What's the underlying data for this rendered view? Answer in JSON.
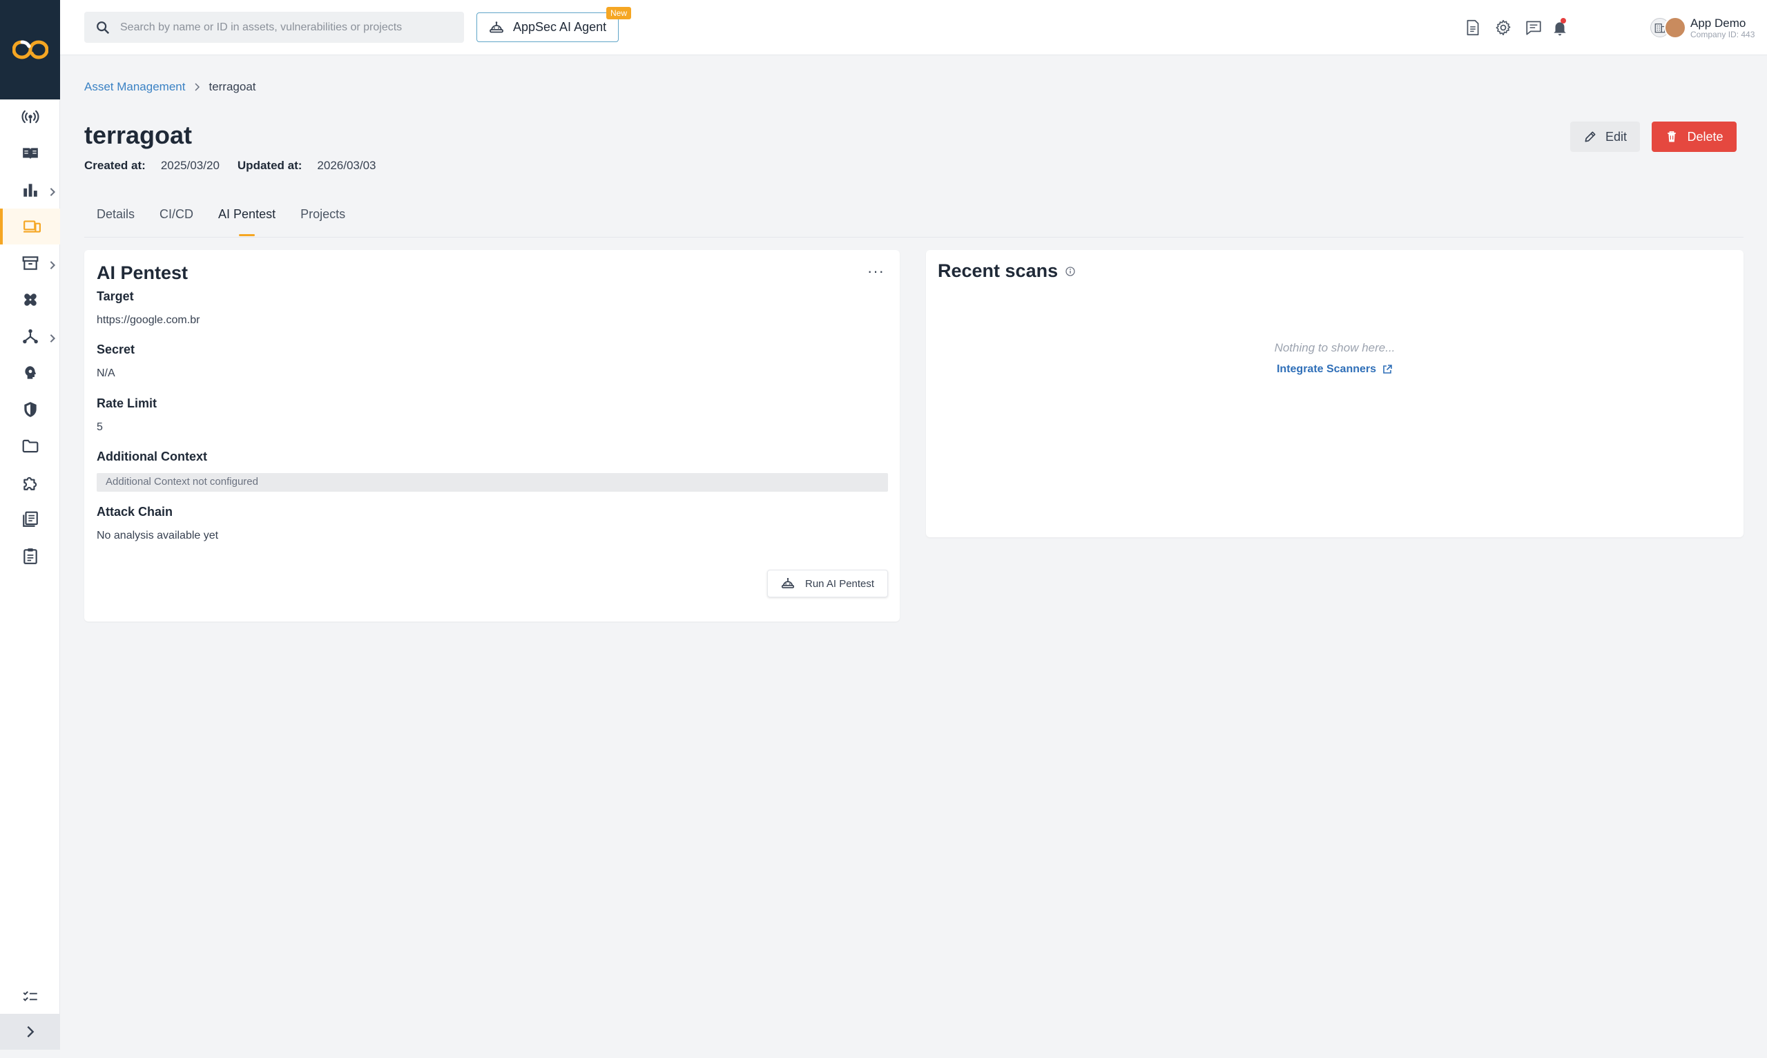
{
  "header": {
    "search_placeholder": "Search by name or ID in assets, vulnerabilities or projects",
    "agent_button": "AppSec AI Agent",
    "new_badge": "New",
    "user_name": "App Demo",
    "company_id": "Company ID: 443"
  },
  "breadcrumb": {
    "parent": "Asset Management",
    "current": "terragoat"
  },
  "page": {
    "title": "terragoat",
    "created_label": "Created at:",
    "created_value": "2025/03/20",
    "updated_label": "Updated at:",
    "updated_value": "2026/03/03",
    "edit_label": "Edit",
    "delete_label": "Delete"
  },
  "tabs": [
    {
      "label": "Details"
    },
    {
      "label": "CI/CD"
    },
    {
      "label": "AI Pentest"
    },
    {
      "label": "Projects"
    }
  ],
  "active_tab": "AI Pentest",
  "pentest": {
    "title": "AI Pentest",
    "more": "···",
    "target_label": "Target",
    "target_value": "https://google.com.br",
    "secret_label": "Secret",
    "secret_value": "N/A",
    "rate_label": "Rate Limit",
    "rate_value": "5",
    "context_label": "Additional Context",
    "context_value": "Additional Context not configured",
    "chain_label": "Attack Chain",
    "chain_value": "No analysis available yet",
    "run_button": "Run AI Pentest"
  },
  "recent": {
    "title": "Recent scans",
    "empty": "Nothing to show here...",
    "integrate": "Integrate Scanners"
  },
  "colors": {
    "accent": "#f5a623",
    "danger": "#e5483f",
    "link": "#3b82c4",
    "sidebar_logo_bg": "#1a2b3c"
  },
  "icons": {
    "sidebar": [
      "signal-icon",
      "book-icon",
      "bar-chart-icon",
      "devices-icon",
      "archive-icon",
      "bandage-icon",
      "network-icon",
      "brain-icon",
      "shield-icon",
      "folder-icon",
      "puzzle-icon",
      "reports-icon",
      "clipboard-icon",
      "checklist-icon",
      "chevron-right-icon"
    ],
    "header": [
      "search-icon",
      "robot-icon",
      "document-icon",
      "gear-icon",
      "chat-icon",
      "bell-icon",
      "chevron-down-icon"
    ]
  }
}
